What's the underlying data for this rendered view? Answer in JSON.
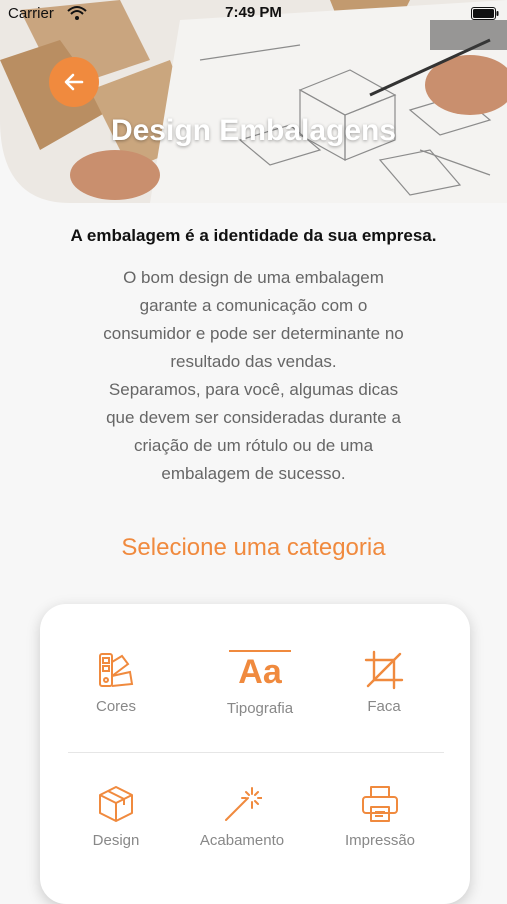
{
  "status_bar": {
    "carrier": "Carrier",
    "time": "7:49 PM"
  },
  "header": {
    "title": "Design Embalagens",
    "back_icon": "arrow-left-icon",
    "accent_color": "#f08a3e"
  },
  "intro": {
    "subtitle": "A embalagem é a identidade da sua empresa.",
    "description": "O bom design de uma embalagem\ngarante a comunicação com o\nconsumidor e pode ser determinante no\nresultado das vendas.\nSeparamos, para você, algumas dicas\nque devem ser consideradas durante a\ncriação de um rótulo ou de uma\nembalagem de sucesso."
  },
  "categories": {
    "title": "Selecione uma categoria",
    "items": [
      {
        "label": "Cores",
        "icon": "color-swatch-icon"
      },
      {
        "label": "Tipografia",
        "icon": "typography-icon",
        "glyph": "Aa"
      },
      {
        "label": "Faca",
        "icon": "crop-icon"
      },
      {
        "label": "Design",
        "icon": "box-icon"
      },
      {
        "label": "Acabamento",
        "icon": "magic-wand-icon"
      },
      {
        "label": "Impressão",
        "icon": "printer-icon"
      }
    ]
  }
}
